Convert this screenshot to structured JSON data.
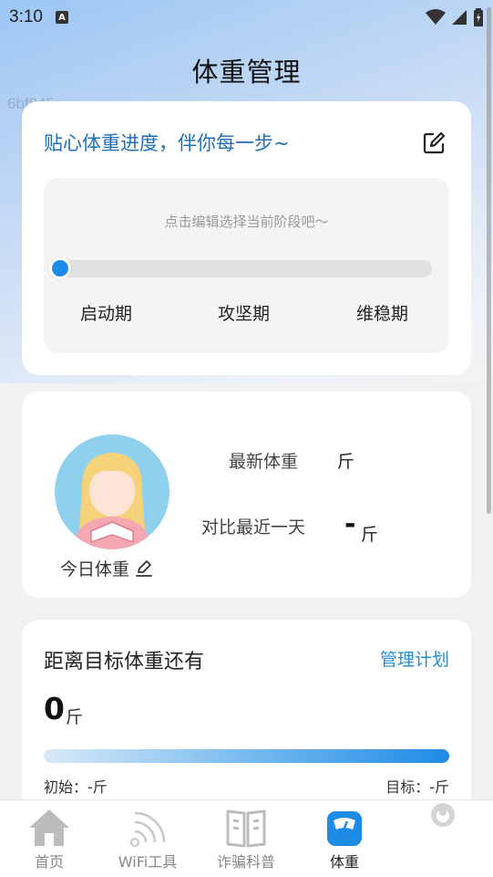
{
  "status_bar": {
    "time": "3:10",
    "badge": "A"
  },
  "header": {
    "title": "体重管理"
  },
  "watermark": "6bf845",
  "progress_card": {
    "slogan": "贴心体重进度，伴你每一步~",
    "hint": "点击编辑选择当前阶段吧～",
    "progress_fraction": 0,
    "stages": [
      "启动期",
      "攻坚期",
      "维稳期"
    ]
  },
  "weight_card": {
    "today_label": "今日体重",
    "latest_label": "最新体重",
    "latest_unit": "斤",
    "compare_label": "对比最近一天",
    "compare_value": "-",
    "compare_unit": "斤"
  },
  "goal_card": {
    "title": "距离目标体重还有",
    "manage_label": "管理计划",
    "value": "0",
    "unit": "斤",
    "start_label": "初始：-斤",
    "target_label": "目标：-斤"
  },
  "tabs": [
    {
      "label": "首页",
      "icon": "home-icon"
    },
    {
      "label": "WiFi工具",
      "icon": "wifi-icon"
    },
    {
      "label": "诈骗科普",
      "icon": "book-icon"
    },
    {
      "label": "体重",
      "icon": "scale-icon"
    }
  ],
  "colors": {
    "accent": "#1e8be6",
    "slogan": "#1f6fb8",
    "link": "#2a8cd0"
  }
}
